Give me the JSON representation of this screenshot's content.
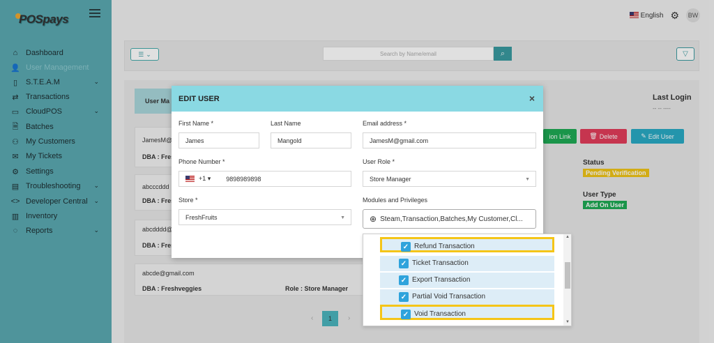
{
  "app": {
    "logo_text": "POSpays"
  },
  "sidebar": {
    "items": [
      {
        "label": "Dashboard",
        "icon": "home-icon"
      },
      {
        "label": "User Management",
        "icon": "user-icon"
      },
      {
        "label": "S.T.E.A.M",
        "icon": "tablet-icon",
        "expandable": true
      },
      {
        "label": "Transactions",
        "icon": "transfer-icon"
      },
      {
        "label": "CloudPOS",
        "icon": "pos-icon",
        "expandable": true
      },
      {
        "label": "Batches",
        "icon": "file-icon"
      },
      {
        "label": "My Customers",
        "icon": "person-icon"
      },
      {
        "label": "My Tickets",
        "icon": "ticket-icon"
      },
      {
        "label": "Settings",
        "icon": "gear-icon"
      },
      {
        "label": "Troubleshooting",
        "icon": "tools-icon",
        "expandable": true
      },
      {
        "label": "Developer Central",
        "icon": "code-icon",
        "expandable": true
      },
      {
        "label": "Inventory",
        "icon": "inventory-icon"
      },
      {
        "label": "Reports",
        "icon": "chat-icon",
        "expandable": true
      }
    ]
  },
  "header": {
    "language": "English",
    "avatar_initials": "BW"
  },
  "toolbar": {
    "search_placeholder": "Search by Name/email"
  },
  "list": {
    "tab_label": "User Ma",
    "last_login_label": "Last Login",
    "last_login_value": "-- -- ----",
    "cards": [
      {
        "email": "JamesM@",
        "dba": "DBA : Fres"
      },
      {
        "email": "abcccddd",
        "dba": "DBA : Fres"
      },
      {
        "email": "abcdddd@",
        "dba": "DBA : Fres"
      },
      {
        "email": "abcde@gmail.com",
        "dba": "DBA : Freshveggies",
        "role": "Role : Store Manager"
      }
    ],
    "actions": {
      "link": "ion Link",
      "delete": "Delete",
      "edit": "Edit User"
    },
    "status_label": "Status",
    "status_value": "Pending Verification",
    "user_type_label": "User Type",
    "user_type_value": "Add On User",
    "page": "1"
  },
  "modal": {
    "title": "EDIT USER",
    "close": "×",
    "first_name_label": "First Name *",
    "first_name": "James",
    "last_name_label": "Last Name",
    "last_name": "Mangold",
    "email_label": "Email address *",
    "email": "JamesM@gmail.com",
    "phone_label": "Phone Number *",
    "phone_code": "+1 ▾",
    "phone": "9898989898",
    "role_label": "User Role *",
    "role": "Store Manager",
    "store_label": "Store *",
    "store": "FreshFruits",
    "modules_label": "Modules and Privileges",
    "modules": "Steam,Transaction,Batches,My Customer,Cl..."
  },
  "privileges": [
    {
      "label": "Refund Transaction",
      "checked": true,
      "highlighted": true
    },
    {
      "label": "Ticket Transaction",
      "checked": true,
      "highlighted": false
    },
    {
      "label": "Export Transaction",
      "checked": true,
      "highlighted": false
    },
    {
      "label": "Partial Void Transaction",
      "checked": true,
      "highlighted": false
    },
    {
      "label": "Void Transaction",
      "checked": true,
      "highlighted": true
    }
  ],
  "colors": {
    "sidebar": "#5aa9b1",
    "modal_header": "#8ad9e3",
    "accent": "#3a9aa0",
    "highlight": "#f5c518",
    "checkbox": "#2fa3dc"
  }
}
